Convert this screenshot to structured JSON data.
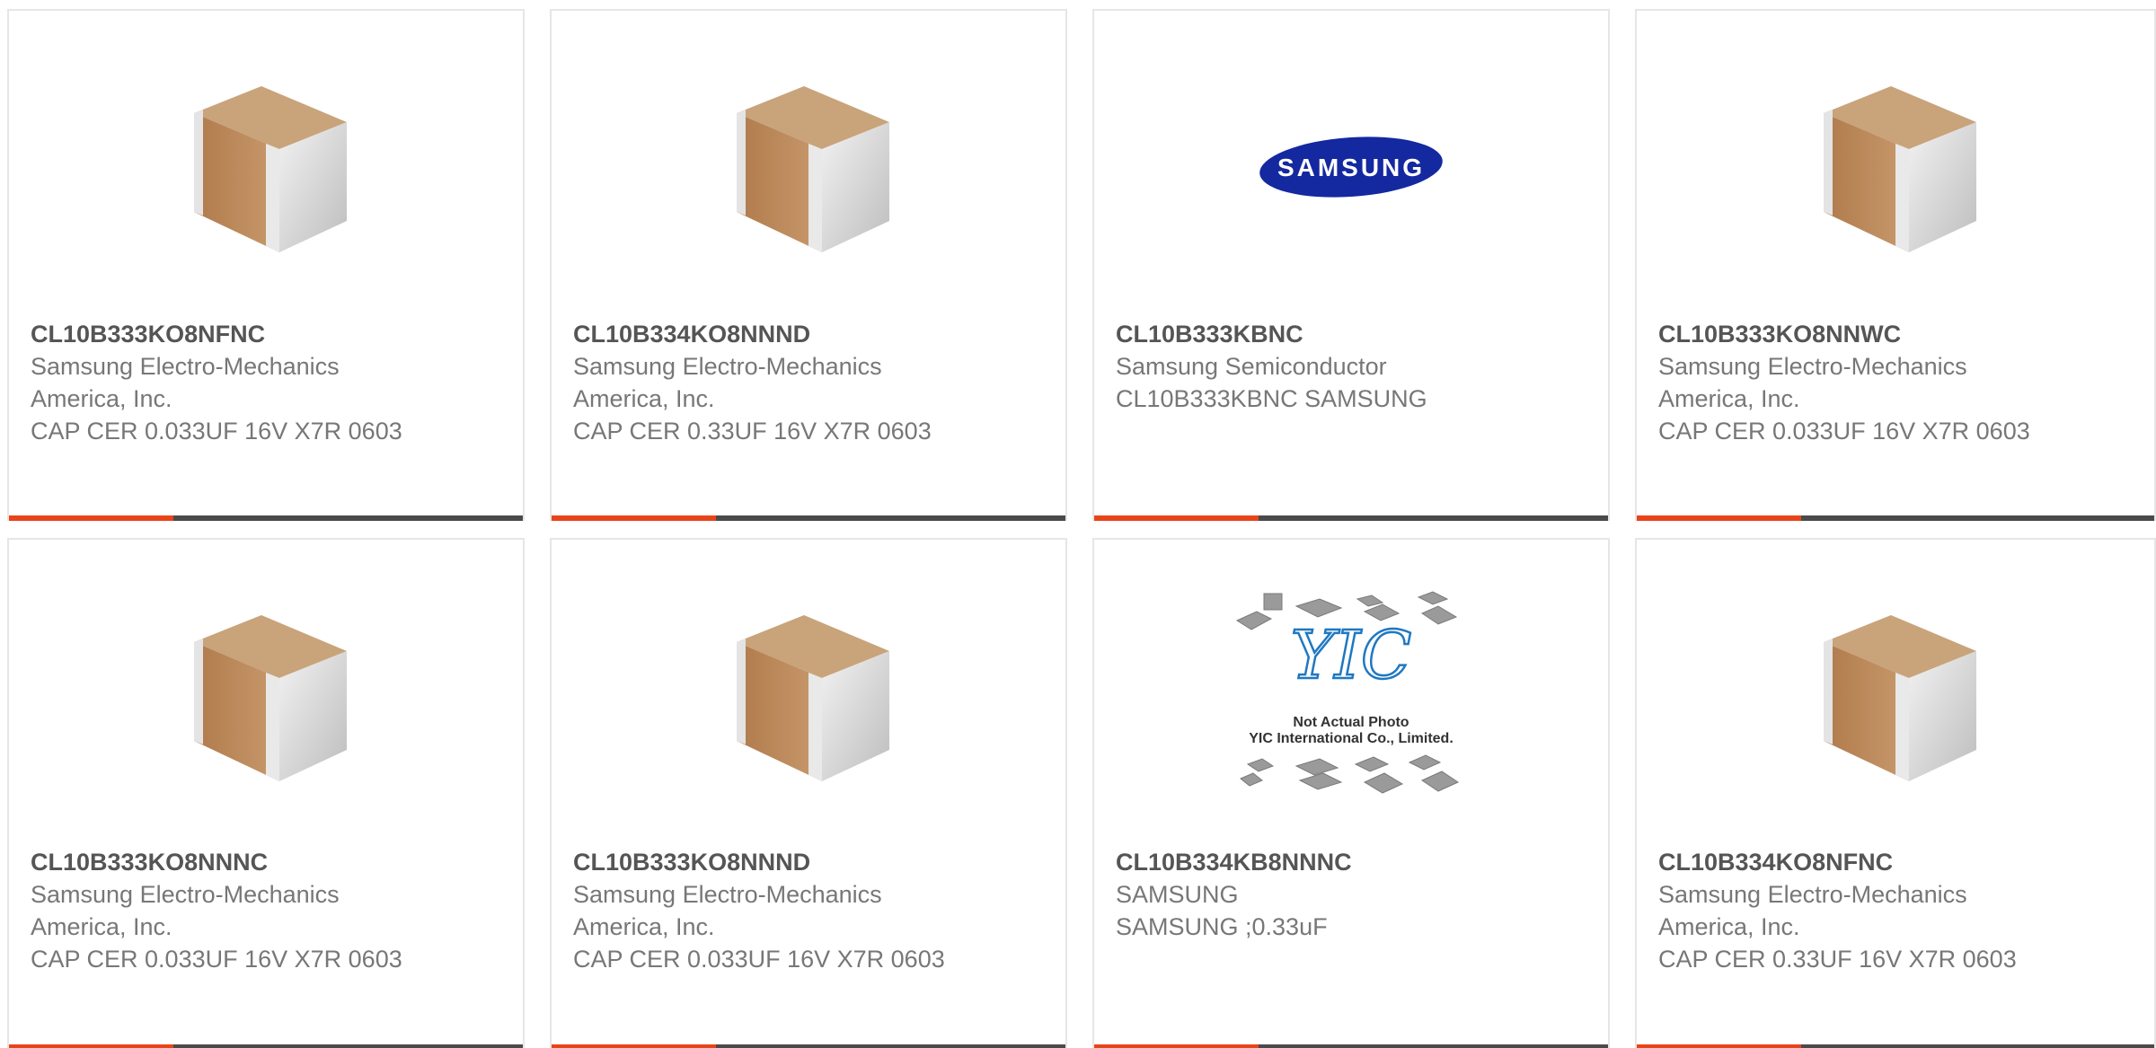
{
  "colors": {
    "accent": "#e8441a",
    "bar": "#4a4a4a",
    "part_number": "#555555",
    "text": "#777777",
    "samsung_blue": "#1428a0"
  },
  "cards": [
    {
      "part_number": "CL10B333KO8NFNC",
      "manufacturer": "Samsung Electro-Mechanics America, Inc.",
      "description": "CAP CER 0.033UF 16V X7R 0603",
      "image": "mlcc-chip-capacitor"
    },
    {
      "part_number": "CL10B334KO8NNND",
      "manufacturer": "Samsung Electro-Mechanics America, Inc.",
      "description": "CAP CER 0.33UF 16V X7R 0603",
      "image": "mlcc-chip-capacitor"
    },
    {
      "part_number": "CL10B333KBNC",
      "manufacturer": "Samsung Semiconductor",
      "description": "CL10B333KBNC SAMSUNG",
      "image": "samsung-logo",
      "logo_text": "SAMSUNG"
    },
    {
      "part_number": "CL10B333KO8NNWC",
      "manufacturer": "Samsung Electro-Mechanics America, Inc.",
      "description": "CAP CER 0.033UF 16V X7R 0603",
      "image": "mlcc-chip-capacitor"
    },
    {
      "part_number": "CL10B333KO8NNNC",
      "manufacturer": "Samsung Electro-Mechanics America, Inc.",
      "description": "CAP CER 0.033UF 16V X7R 0603",
      "image": "mlcc-chip-capacitor"
    },
    {
      "part_number": "CL10B333KO8NNND",
      "manufacturer": "Samsung Electro-Mechanics America, Inc.",
      "description": "CAP CER 0.033UF 16V X7R 0603",
      "image": "mlcc-chip-capacitor"
    },
    {
      "part_number": "CL10B334KB8NNNC",
      "manufacturer": "SAMSUNG",
      "description": "SAMSUNG ;0.33uF",
      "image": "yic-not-actual-photo",
      "placeholder_lines": [
        "Not Actual Photo",
        "YIC International Co., Limited."
      ],
      "placeholder_logo": "YIC"
    },
    {
      "part_number": "CL10B334KO8NFNC",
      "manufacturer": "Samsung Electro-Mechanics America, Inc.",
      "description": "CAP CER 0.33UF 16V X7R 0603",
      "image": "mlcc-chip-capacitor"
    }
  ]
}
